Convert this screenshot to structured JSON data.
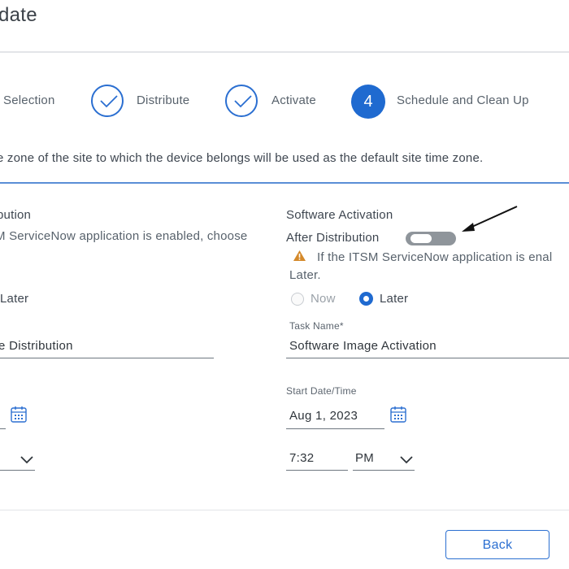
{
  "header": {
    "title": "date"
  },
  "stepper": {
    "steps": [
      {
        "label": "Selection",
        "state": "completed"
      },
      {
        "label": "Distribute",
        "state": "completed"
      },
      {
        "label": "Activate",
        "state": "completed"
      },
      {
        "label": "Schedule and Clean Up",
        "number": "4",
        "state": "active"
      }
    ]
  },
  "info_text": "e zone of the site to which the device belongs will be used as the default site time zone.",
  "left_panel": {
    "section_title": "bution",
    "description": "M ServiceNow application is enabled, choose",
    "radio_later_label": "Later",
    "task_name_value": "e Distribution",
    "time_dropdown_icon": "chevron-down-icon",
    "calendar_icon": "calendar-icon"
  },
  "right_panel": {
    "section_title": "Software Activation",
    "after_distribution_label": "After Distribution",
    "toggle_on": false,
    "warning_text": "If the ITSM ServiceNow application is enal",
    "warning_text_cont": "Later.",
    "radio_now_label": "Now",
    "radio_later_label": "Later",
    "selected_option": "Later",
    "task_name_label": "Task Name*",
    "task_name_value": "Software Image Activation",
    "start_label": "Start Date/Time",
    "date_value": "Aug 1, 2023",
    "time_value": "7:32",
    "ampm_value": "PM"
  },
  "footer": {
    "back_label": "Back"
  },
  "colors": {
    "accent": "#1f6ad0",
    "toggle_off": "#8f959b",
    "warning": "#d4892a"
  }
}
